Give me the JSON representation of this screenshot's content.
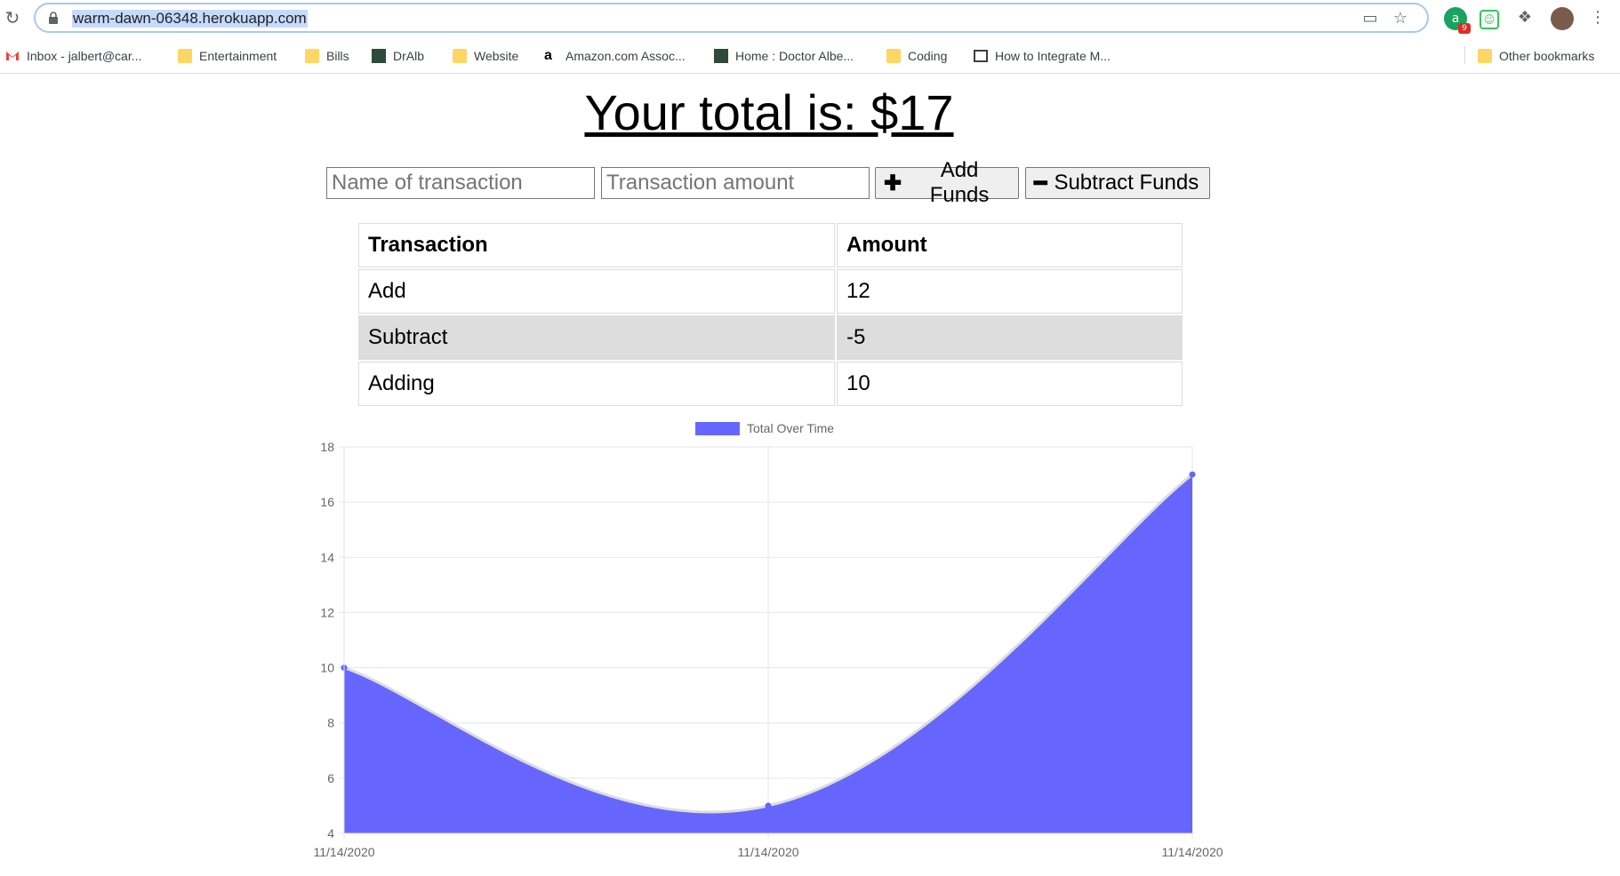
{
  "browser": {
    "url": "warm-dawn-06348.herokuapp.com",
    "bookmarks": [
      {
        "label": "Inbox - jalbert@car...",
        "icon": "gmail-icon"
      },
      {
        "label": "Entertainment",
        "icon": "folder-icon"
      },
      {
        "label": "Bills",
        "icon": "folder-icon"
      },
      {
        "label": "DrAlb",
        "icon": "site-icon"
      },
      {
        "label": "Website",
        "icon": "folder-icon"
      },
      {
        "label": "Amazon.com Assoc...",
        "icon": "amazon-icon"
      },
      {
        "label": "Home : Doctor Albe...",
        "icon": "site-icon"
      },
      {
        "label": "Coding",
        "icon": "folder-icon"
      },
      {
        "label": "How to Integrate M...",
        "icon": "page-icon"
      }
    ],
    "other_bookmarks": "Other bookmarks",
    "extension_badge": "9"
  },
  "page": {
    "title": "Your total is: $17",
    "form": {
      "name_placeholder": "Name of transaction",
      "amount_placeholder": "Transaction amount",
      "add_label": "Add Funds",
      "subtract_label": "Subtract Funds"
    },
    "table": {
      "headers": [
        "Transaction",
        "Amount"
      ],
      "rows": [
        {
          "name": "Add",
          "amount": "12"
        },
        {
          "name": "Subtract",
          "amount": "-5"
        },
        {
          "name": "Adding",
          "amount": "10"
        }
      ]
    }
  },
  "chart_data": {
    "type": "area",
    "legend": "Total Over Time",
    "x": [
      "11/14/2020",
      "11/14/2020",
      "11/14/2020"
    ],
    "values": [
      10,
      5,
      17
    ],
    "ylim": [
      4,
      18
    ],
    "yticks": [
      4,
      6,
      8,
      10,
      12,
      14,
      16,
      18
    ],
    "fill_color": "#6666ff",
    "line_color": "#dcdcdc",
    "grid": true
  },
  "colors": {
    "url_highlight": "#c6dafc",
    "row_shade": "#dddddd"
  }
}
